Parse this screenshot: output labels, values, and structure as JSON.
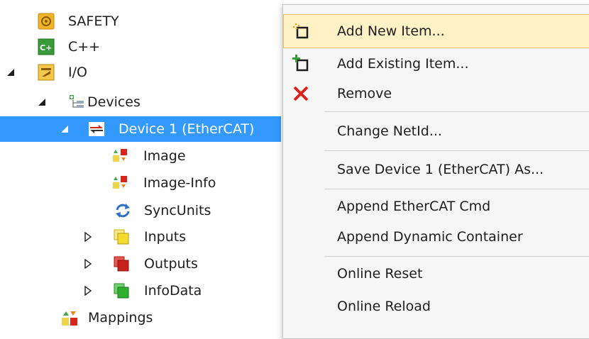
{
  "tree": {
    "items": [
      {
        "label": "SAFETY",
        "icon": "safety-icon"
      },
      {
        "label": "C++",
        "icon": "cpp-icon"
      },
      {
        "label": "I/O",
        "icon": "io-icon"
      },
      {
        "label": "Devices",
        "icon": "devices-icon"
      },
      {
        "label": "Device 1 (EtherCAT)",
        "icon": "ethercat-device-icon",
        "selected": true
      },
      {
        "label": "Image",
        "icon": "image-icon"
      },
      {
        "label": "Image-Info",
        "icon": "image-info-icon"
      },
      {
        "label": "SyncUnits",
        "icon": "sync-units-icon"
      },
      {
        "label": "Inputs",
        "icon": "inputs-icon"
      },
      {
        "label": "Outputs",
        "icon": "outputs-icon"
      },
      {
        "label": "InfoData",
        "icon": "info-data-icon"
      },
      {
        "label": "Mappings",
        "icon": "mappings-icon"
      }
    ]
  },
  "context_menu": {
    "items": [
      {
        "label": "Add New Item...",
        "icon": "add-new-item-icon",
        "highlighted": true
      },
      {
        "label": "Add Existing Item...",
        "icon": "add-existing-item-icon"
      },
      {
        "label": "Remove",
        "icon": "remove-icon"
      },
      {
        "label": "Change NetId..."
      },
      {
        "label": "Save Device 1 (EtherCAT) As..."
      },
      {
        "label": "Append EtherCAT Cmd"
      },
      {
        "label": "Append Dynamic Container"
      },
      {
        "label": "Online Reset"
      },
      {
        "label": "Online Reload"
      }
    ]
  },
  "colors": {
    "selection": "#3399ff",
    "menu_background": "#f6f6f6",
    "menu_hover": "#fef2c6",
    "remove_red": "#d9261c"
  }
}
